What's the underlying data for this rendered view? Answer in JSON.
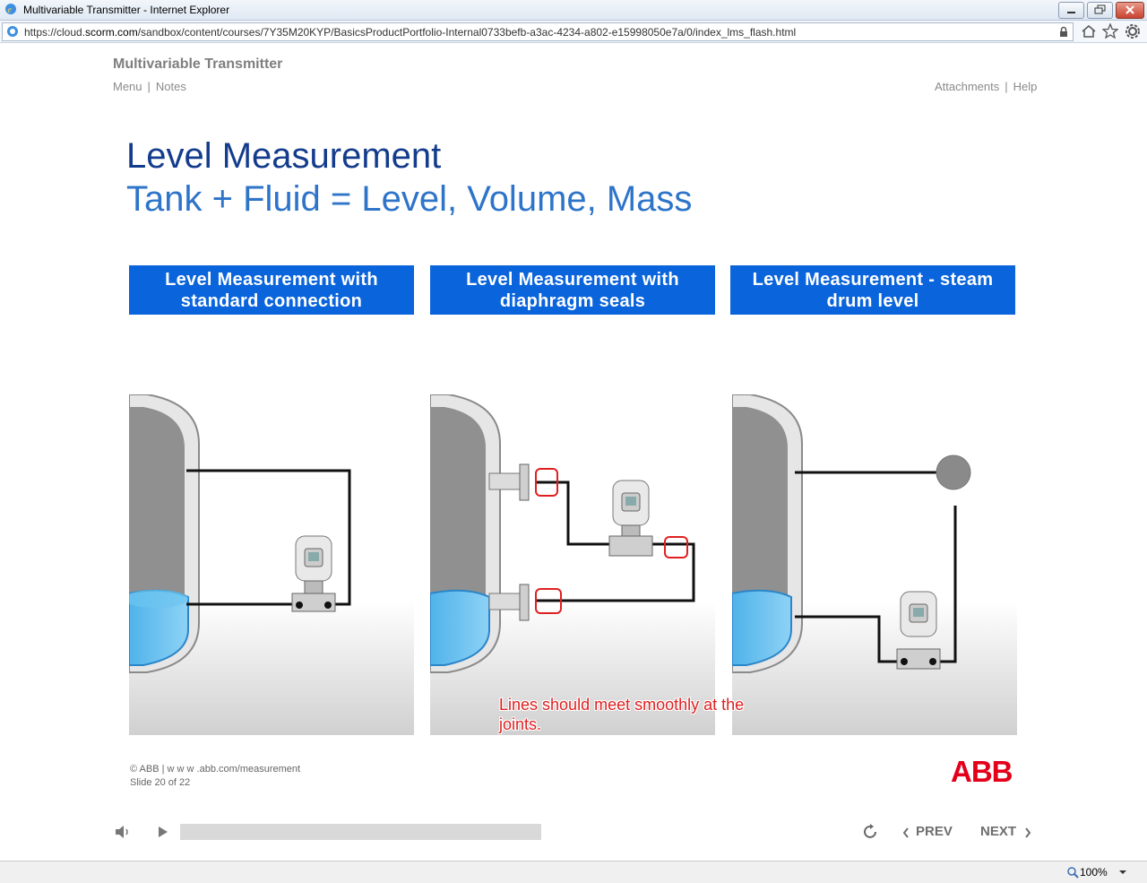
{
  "window": {
    "title": "Multivariable Transmitter - Internet Explorer",
    "url_prefix": "https://cloud.",
    "url_domain": "scorm.com",
    "url_rest": "/sandbox/content/courses/7Y35M20KYP/BasicsProductPortfolio-Internal0733befb-a3ac-4234-a802-e15998050e7a/0/index_lms_flash.html"
  },
  "course": {
    "title": "Multivariable Transmitter",
    "nav_left": [
      "Menu",
      "Notes"
    ],
    "nav_right": [
      "Attachments",
      "Help"
    ]
  },
  "slide": {
    "heading": "Level Measurement",
    "subheading": "Tank + Fluid = Level, Volume, Mass",
    "panels": [
      {
        "label": "Level Measurement with standard connection"
      },
      {
        "label": "Level Measurement with diaphragm seals"
      },
      {
        "label": "Level Measurement - steam drum level"
      }
    ],
    "annotation": "Lines should meet smoothly at the joints.",
    "footer_line1": "© ABB | w w w .abb.com/measurement",
    "footer_line2": "Slide 20 of 22",
    "logo": "ABB"
  },
  "player": {
    "prev_label": "PREV",
    "next_label": "NEXT",
    "progress": 0.0
  },
  "statusbar": {
    "zoom": "100%"
  },
  "colors": {
    "header_blue": "#0a64dc",
    "heading_dark_blue": "#143c8c",
    "heading_blue": "#2e74c9",
    "annotation_red": "#e02020",
    "abb_red": "#e2001a"
  }
}
